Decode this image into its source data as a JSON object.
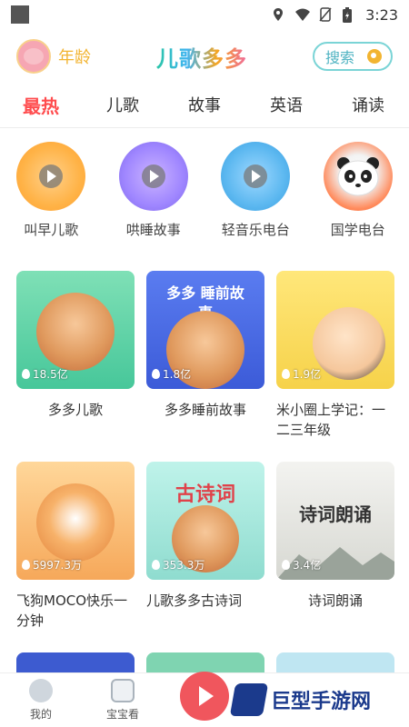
{
  "status_bar": {
    "time": "3:23"
  },
  "header": {
    "age_label": "年龄",
    "brand": "儿歌多多",
    "search_label": "搜索"
  },
  "tabs": [
    "最热",
    "儿歌",
    "故事",
    "英语",
    "诵读"
  ],
  "radios": [
    {
      "label": "叫早儿歌"
    },
    {
      "label": "哄睡故事"
    },
    {
      "label": "轻音乐电台"
    },
    {
      "label": "国学电台"
    }
  ],
  "cards": [
    {
      "title": "多多儿歌",
      "plays": "18.5亿"
    },
    {
      "title": "多多睡前故事",
      "plays": "1.8亿",
      "badge_title": "多多 睡前故事"
    },
    {
      "title": "米小圈上学记：一二三年级",
      "plays": "1.9亿"
    },
    {
      "title": "飞狗MOCO快乐一分钟",
      "plays": "5997.3万"
    },
    {
      "title": "儿歌多多古诗词",
      "plays": "353.3万",
      "badge_title": "古诗词"
    },
    {
      "title": "诗词朗诵",
      "plays": "3.4亿",
      "badge_title": "诗词朗诵"
    }
  ],
  "bottom_tabs": {
    "mine": "我的",
    "watch": "宝宝看"
  },
  "watermark": "巨型手游网",
  "colors": {
    "accent": "#ff4d4f",
    "highlight": "#ffd24a",
    "search_border": "#7ad4d6"
  }
}
